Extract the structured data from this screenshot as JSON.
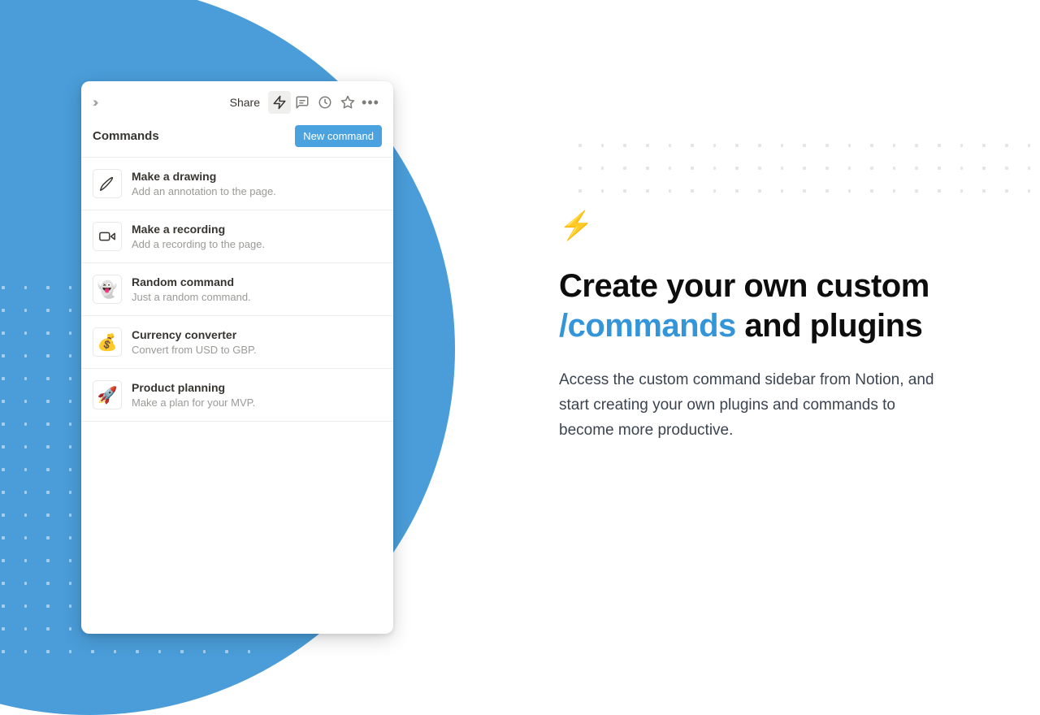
{
  "panel": {
    "share_label": "Share",
    "header_title": "Commands",
    "new_button_label": "New command",
    "commands": [
      {
        "title": "Make a drawing",
        "desc": "Add an annotation to the page.",
        "icon": "pen"
      },
      {
        "title": "Make a recording",
        "desc": "Add a recording to the page.",
        "icon": "video"
      },
      {
        "title": "Random command",
        "desc": "Just a random command.",
        "icon": "👻"
      },
      {
        "title": "Currency converter",
        "desc": "Convert from USD to GBP.",
        "icon": "💰"
      },
      {
        "title": "Product planning",
        "desc": "Make a plan for your MVP.",
        "icon": "🚀"
      }
    ]
  },
  "marketing": {
    "bolt_icon": "⚡",
    "headline_pre": "Create your own custom ",
    "headline_accent": "/commands",
    "headline_post": " and plugins",
    "subtext": "Access the custom command sidebar from Notion, and start creating your own plugins and commands to become more productive."
  }
}
